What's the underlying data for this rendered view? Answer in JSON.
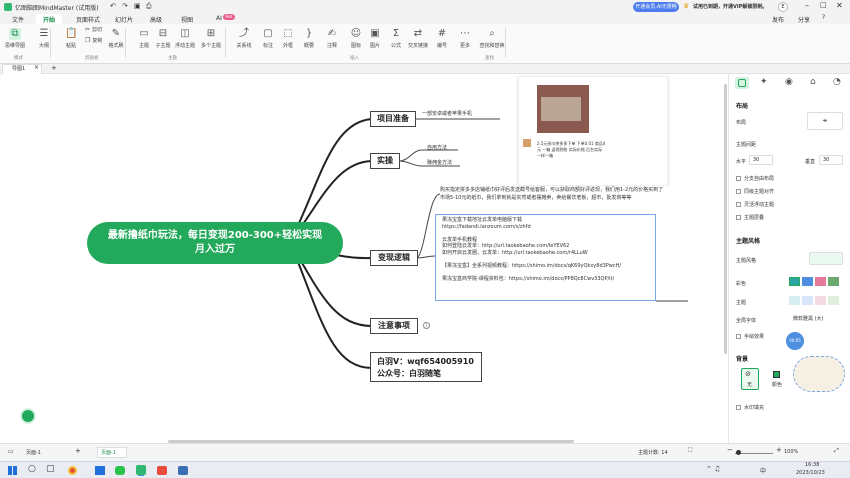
{
  "app": {
    "title": "亿图脑图MindMaster (试用版)",
    "notice": "开通会员,AI无限畅享",
    "promo": "试用已到期，开通VIP解锁限制。",
    "avatar": "E"
  },
  "menubar": {
    "items": [
      "文件",
      "开始",
      "页面样式",
      "幻灯片",
      "高级",
      "视图",
      "AI"
    ],
    "ai_badge": "Hot",
    "publish": "发布",
    "share": "分享"
  },
  "ribbon": {
    "groups": [
      "模式",
      "剪贴板",
      "主题",
      "插入",
      "查找"
    ],
    "buttons": [
      {
        "icon": "mindmap-icon",
        "label": "思维导图"
      },
      {
        "icon": "outline-icon",
        "label": "大纲"
      },
      {
        "icon": "paste-icon",
        "label": "粘贴"
      },
      {
        "icon": "cut-icon",
        "label": "剪切"
      },
      {
        "icon": "copy-icon",
        "label": "复制"
      },
      {
        "icon": "format-painter-icon",
        "label": "格式刷"
      },
      {
        "icon": "topic-icon",
        "label": "主题"
      },
      {
        "icon": "subtopic-icon",
        "label": "子主题"
      },
      {
        "icon": "floating-topic-icon",
        "label": "浮动主题"
      },
      {
        "icon": "multi-topic-icon",
        "label": "多个主题"
      },
      {
        "icon": "relation-icon",
        "label": "关系线"
      },
      {
        "icon": "callout-icon",
        "label": "标注"
      },
      {
        "icon": "boundary-icon",
        "label": "外框"
      },
      {
        "icon": "summary-icon",
        "label": "概要"
      },
      {
        "icon": "comment-icon",
        "label": "注释"
      },
      {
        "icon": "icon-icon",
        "label": "图标"
      },
      {
        "icon": "image-icon",
        "label": "图片"
      },
      {
        "icon": "formula-icon",
        "label": "公式"
      },
      {
        "icon": "cross-link-icon",
        "label": "交叉链接"
      },
      {
        "icon": "number-icon",
        "label": "编号"
      },
      {
        "icon": "more-icon",
        "label": "更多"
      },
      {
        "icon": "find-replace-icon",
        "label": "查找和替换"
      }
    ]
  },
  "undo_label": "撤销",
  "redo_label": "恢复",
  "sub_cut": "剪切",
  "sub_copy": "复制",
  "tabs": {
    "current": "导图1",
    "add": "+"
  },
  "mindmap": {
    "central": "最新撸纸巾玩法，每日变现200-300+轻松实现月入过万",
    "branches": [
      {
        "label": "项目准备",
        "note": "一部安卓或者苹果手机"
      },
      {
        "label": "实操",
        "children": [
          "自用方法",
          "赚佣金方法"
        ]
      },
      {
        "label": "变现逻辑"
      },
      {
        "label": "注意事项"
      },
      {
        "label": "白羽V：wqf654005910\n公众号：白羽随笔"
      }
    ],
    "paragraph": "购买指定拼多多店铺纸巾好评后发送截号给客服，可以获取商额好评返现，我们用1-2元的价格买到了市场5-10元的纸巾，我们拿到就是实然或者摆摊卖，卖给餐饮老板，超市，批发商等等",
    "link_block": [
      "果冻宝盒下载地址云发单电脑版下载",
      "https://fadandi.lanzoum.com/s/zhfd",
      "",
      "云发单手机教程",
      "如何登陆云发单：http://url.taokebaohe.com/leYEV62",
      "如何开启云发圈，云发单：http://url.taokebaohe.com/r4LLuW",
      "",
      "【果冻宝盒】全系列视频教程：https://shimo.im/docs/qK69yQkxy8d3PwcH/",
      "",
      "果冻宝盒商学院-课程资料包：https://shimo.im/docs/PP8Qc8Cwv33QP/it/"
    ],
    "thumbnail_caption": "2.5元纸巾拼多多下单 下单0.01 商品4元 一箱 返佣到账 实际价格 后台实际 一样一箱"
  },
  "rightpanel": {
    "tab_icons": [
      "layout-icon",
      "style-icon",
      "location-icon",
      "theme-icon",
      "clock-icon"
    ],
    "sections": {
      "layout": "布局",
      "layout_label": "布局",
      "topic_spacing": "主题间距",
      "horizontal": "水平",
      "horizontal_val": "30",
      "vertical": "垂直",
      "vertical_val": "30",
      "checks": [
        "分支自由布局",
        "同级主题对齐",
        "灵活浮动主题",
        "主题层叠"
      ],
      "theme_style": "主题风格",
      "theme_style_label": "主题风格",
      "color": "彩色",
      "theme": "主题",
      "font": "全局字体",
      "font_val": "微软雅黑 (大)",
      "hand": "手绘效果",
      "background": "背景",
      "bg_none": "无",
      "bg_color": "颜色",
      "watermark": "水印填充"
    },
    "timer": "00:05"
  },
  "statusbar": {
    "page": "页面-1",
    "page_tab": "页面-1",
    "topics": "主题计数: 14",
    "zoom": "100%"
  },
  "taskbar": {
    "time": "16:38",
    "date": "2023/10/23",
    "lang": "中"
  }
}
